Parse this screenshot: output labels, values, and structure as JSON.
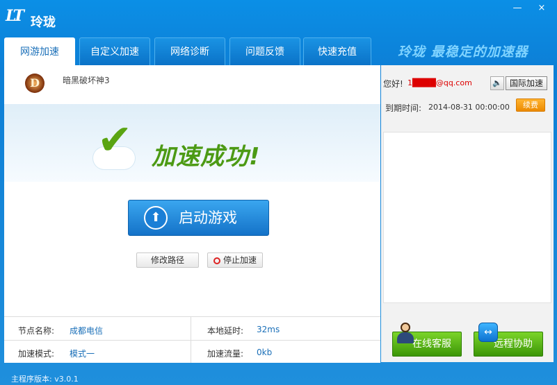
{
  "app": {
    "logo": "LT",
    "title": "玲珑",
    "slogan": "玲珑 最稳定的加速器",
    "minimize": "—",
    "close": "×"
  },
  "tabs": [
    {
      "label": "网游加速",
      "active": true
    },
    {
      "label": "自定义加速",
      "active": false
    },
    {
      "label": "网络诊断",
      "active": false
    },
    {
      "label": "问题反馈",
      "active": false
    },
    {
      "label": "快速充值",
      "active": false
    }
  ],
  "game": {
    "icon": "D",
    "name": "暗黑破坏神3"
  },
  "banner": {
    "check": "✔",
    "text": "加速成功!"
  },
  "actions": {
    "start_icon": "⬆",
    "start_label": "启动游戏",
    "modify_path": "修改路径",
    "stop": "停止加速"
  },
  "stats": {
    "node_label": "节点名称:",
    "node_value": "成都电信",
    "latency_label": "本地延时:",
    "latency_value": "32ms",
    "mode_label": "加速模式:",
    "mode_value": "模式一",
    "traffic_label": "加速流量:",
    "traffic_value": "0kb"
  },
  "user": {
    "greeting": "您好!",
    "email": "1████@qq.com",
    "speaker": "🔈",
    "international": "国际加速",
    "expiry_label": "到期时间:",
    "expiry_value": "2014-08-31 00:00:00",
    "renew": "续费"
  },
  "services": {
    "online": "在线客服",
    "remote": "远程协助",
    "tv_symbol": "↔"
  },
  "status": {
    "version": "主程序版本: v3.0.1"
  },
  "colors": {
    "brand_blue": "#0d7fd6",
    "success_green": "#4c9a14",
    "renew_orange": "#ec8a00",
    "email_red": "#dd0000"
  }
}
